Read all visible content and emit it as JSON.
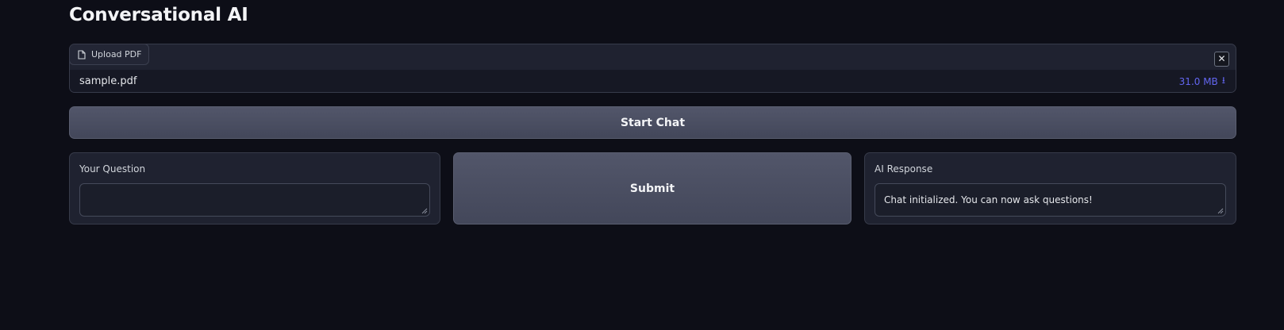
{
  "app": {
    "title": "Conversational AI"
  },
  "upload": {
    "tab_label": "Upload PDF",
    "close_symbol": "✕",
    "file_name": "sample.pdf",
    "file_size": "31.0 MB",
    "download_symbol": "⭳"
  },
  "actions": {
    "start_chat": "Start Chat",
    "submit": "Submit"
  },
  "question": {
    "label": "Your Question",
    "value": ""
  },
  "response": {
    "label": "AI Response",
    "value": "Chat initialized. You can now ask questions!"
  },
  "colors": {
    "background": "#0d0e17",
    "panel": "#1f2230",
    "button": "#4b4f62",
    "accent": "#6366f1"
  }
}
